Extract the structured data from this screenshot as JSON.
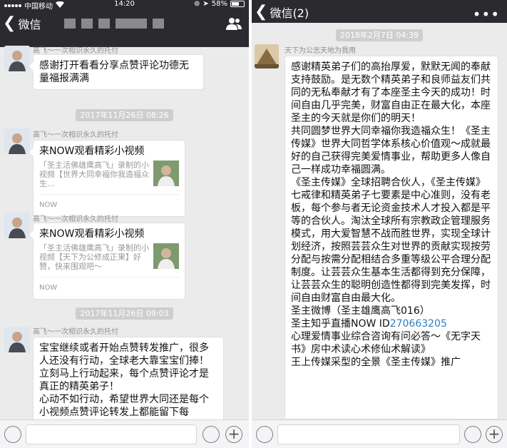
{
  "left": {
    "status": {
      "carrier": "中国移动",
      "time": "14:20",
      "battery": "58%"
    },
    "back_label": "微信",
    "messages": [
      {
        "sender": "高飞～一次相识永久的托付",
        "text": "感谢打开看看分享点赞评论功德无量福报满满"
      },
      {
        "timestamp": "2017年11月26日 08:26"
      },
      {
        "sender": "高飞～一次相识永久的托付",
        "card_title": "来NOW观看精彩小视频",
        "card_desc": "「圣主活佛雄鹰高飞」录制的小视频【世界大同幸福你我造福众生...",
        "card_source": "NOW"
      },
      {
        "sender": "高飞～一次相识永久的托付",
        "card_title": "来NOW观看精彩小视频",
        "card_desc": "「圣主活佛雄鹰高飞」录制的小视频【天下为公修成正果】好赞，快来围观吧～",
        "card_source": "NOW"
      },
      {
        "timestamp": "2017年11月26日 09:03"
      },
      {
        "sender": "高飞～一次相识永久的托付",
        "text": "宝宝继续或者开始点赞转发推广，很多人还没有行动，全球老大靠宝宝们捧！立刻马上行动起来，每个点赞评论才是真正的精英弟子！\n心动不如行动，希望世界大同还是每个小视频点赞评论转发上都能留下每"
      }
    ]
  },
  "right": {
    "back_label": "微信(2)",
    "messages": [
      {
        "timestamp": "2018年2月7日 04:39"
      },
      {
        "sender": "天下为公志天地为我用",
        "text_before_link": "感谢精英弟子们的高抬厚爱，默默无闻的奉献支持鼓励。是无数个精英弟子和良师益友们共同的无私奉献才有了本座圣主今天的成功！时间自由几乎完美，财富自由正在最大化，本座圣主的今天就是你们的明天！\n共同圆梦世界大同幸福你我造福众生！《圣主传媒》世界大同哲学体系核心价值观～成就最好的自己获得完美爱情事业，帮助更多人像自己一样成功幸福圆满。\n《圣主传媒》全球招聘合伙人，《圣主传媒》七戒律和精英弟子七要素是中心准则，没有老板，每个参与者无论资金技术人才投入都是平等的合伙人。淘汰全球所有宗教政企管理服务模式，用大爱智慧不战而胜世界，实现全球计划经济，按照芸芸众生对世界的贡献实现按劳分配与按需分配相结合多重等级公平合理分配制度。让芸芸众生基本生活都得到充分保障，让芸芸众生的聪明创造性都得到完美发挥，时间自由财富自由最大化。\n圣主微博（圣主雄鹰高飞016）\n圣主知乎直播NOW ID",
        "link": "270663205",
        "text_after_link": "\n心理爱情事业综合咨询有问必答～《无字天书》房中术读心术修仙术解读》\n王上传媒采型的全景《圣主传媒》推广"
      }
    ]
  },
  "colors": {
    "navbar": "#2b2b2f",
    "chat_bg": "#ebebeb",
    "link": "#2f7ec2"
  }
}
